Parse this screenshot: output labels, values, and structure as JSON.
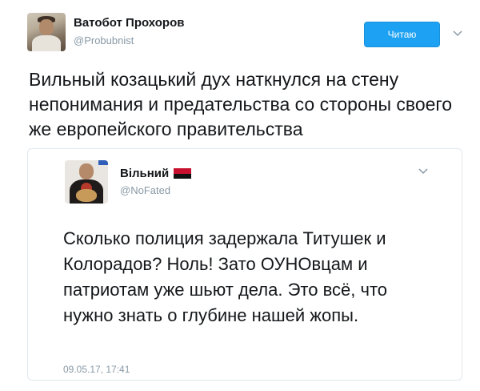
{
  "author": {
    "name": "Ватобот Прохоров",
    "handle": "@Probubnist"
  },
  "follow_button": {
    "label": "Читаю",
    "color": "#1da1f2"
  },
  "tweet": {
    "text": "Вильный козацький дух наткнулся на стену непонимания и предательства со стороны своего же европейского правительства"
  },
  "quoted_tweet": {
    "author_name": "Вільний",
    "author_handle": "@NoFated",
    "text": "Сколько полиция задержала Титушек и Колорадов? Ноль! Зато ОУНОвцам и патриотам уже шьют дела. Это всё, что нужно знать о глубине нашей жопы.",
    "timestamp": "09.05.17, 17:41"
  },
  "icons": {
    "menu": "chevron-down-icon",
    "flag": "red-black-flag-icon"
  }
}
